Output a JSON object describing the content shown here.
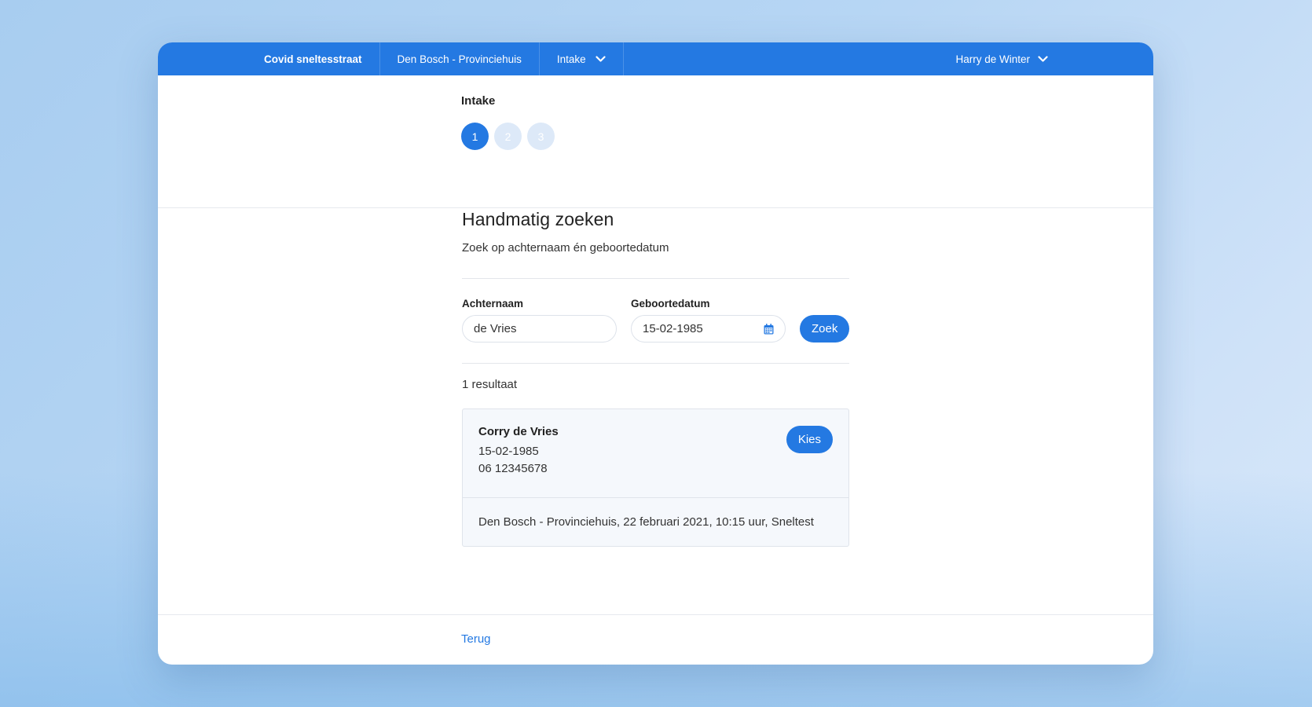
{
  "colors": {
    "accent": "#2479e2",
    "step_inactive": "#dde9f8",
    "card_bg": "#f5f8fc"
  },
  "navbar": {
    "brand": "Covid sneltesstraat",
    "location": "Den Bosch - Provinciehuis",
    "menu": "Intake",
    "user": "Harry de Winter"
  },
  "stepper": {
    "title": "Intake",
    "steps": [
      "1",
      "2",
      "3"
    ],
    "active_step": 1
  },
  "main": {
    "title": "Handmatig zoeken",
    "subtitle": "Zoek op achternaam én geboortedatum"
  },
  "form": {
    "lastname_label": "Achternaam",
    "lastname_value": "de Vries",
    "birthdate_label": "Geboortedatum",
    "birthdate_value": "15-02-1985",
    "search_button": "Zoek"
  },
  "results": {
    "count_text": "1 resultaat",
    "items": [
      {
        "name": "Corry de Vries",
        "birthdate": "15-02-1985",
        "phone": "06 12345678",
        "choose_button": "Kies",
        "appointment": "Den Bosch - Provinciehuis, 22 februari 2021, 10:15 uur, Sneltest"
      }
    ]
  },
  "footer": {
    "back_link": "Terug"
  }
}
